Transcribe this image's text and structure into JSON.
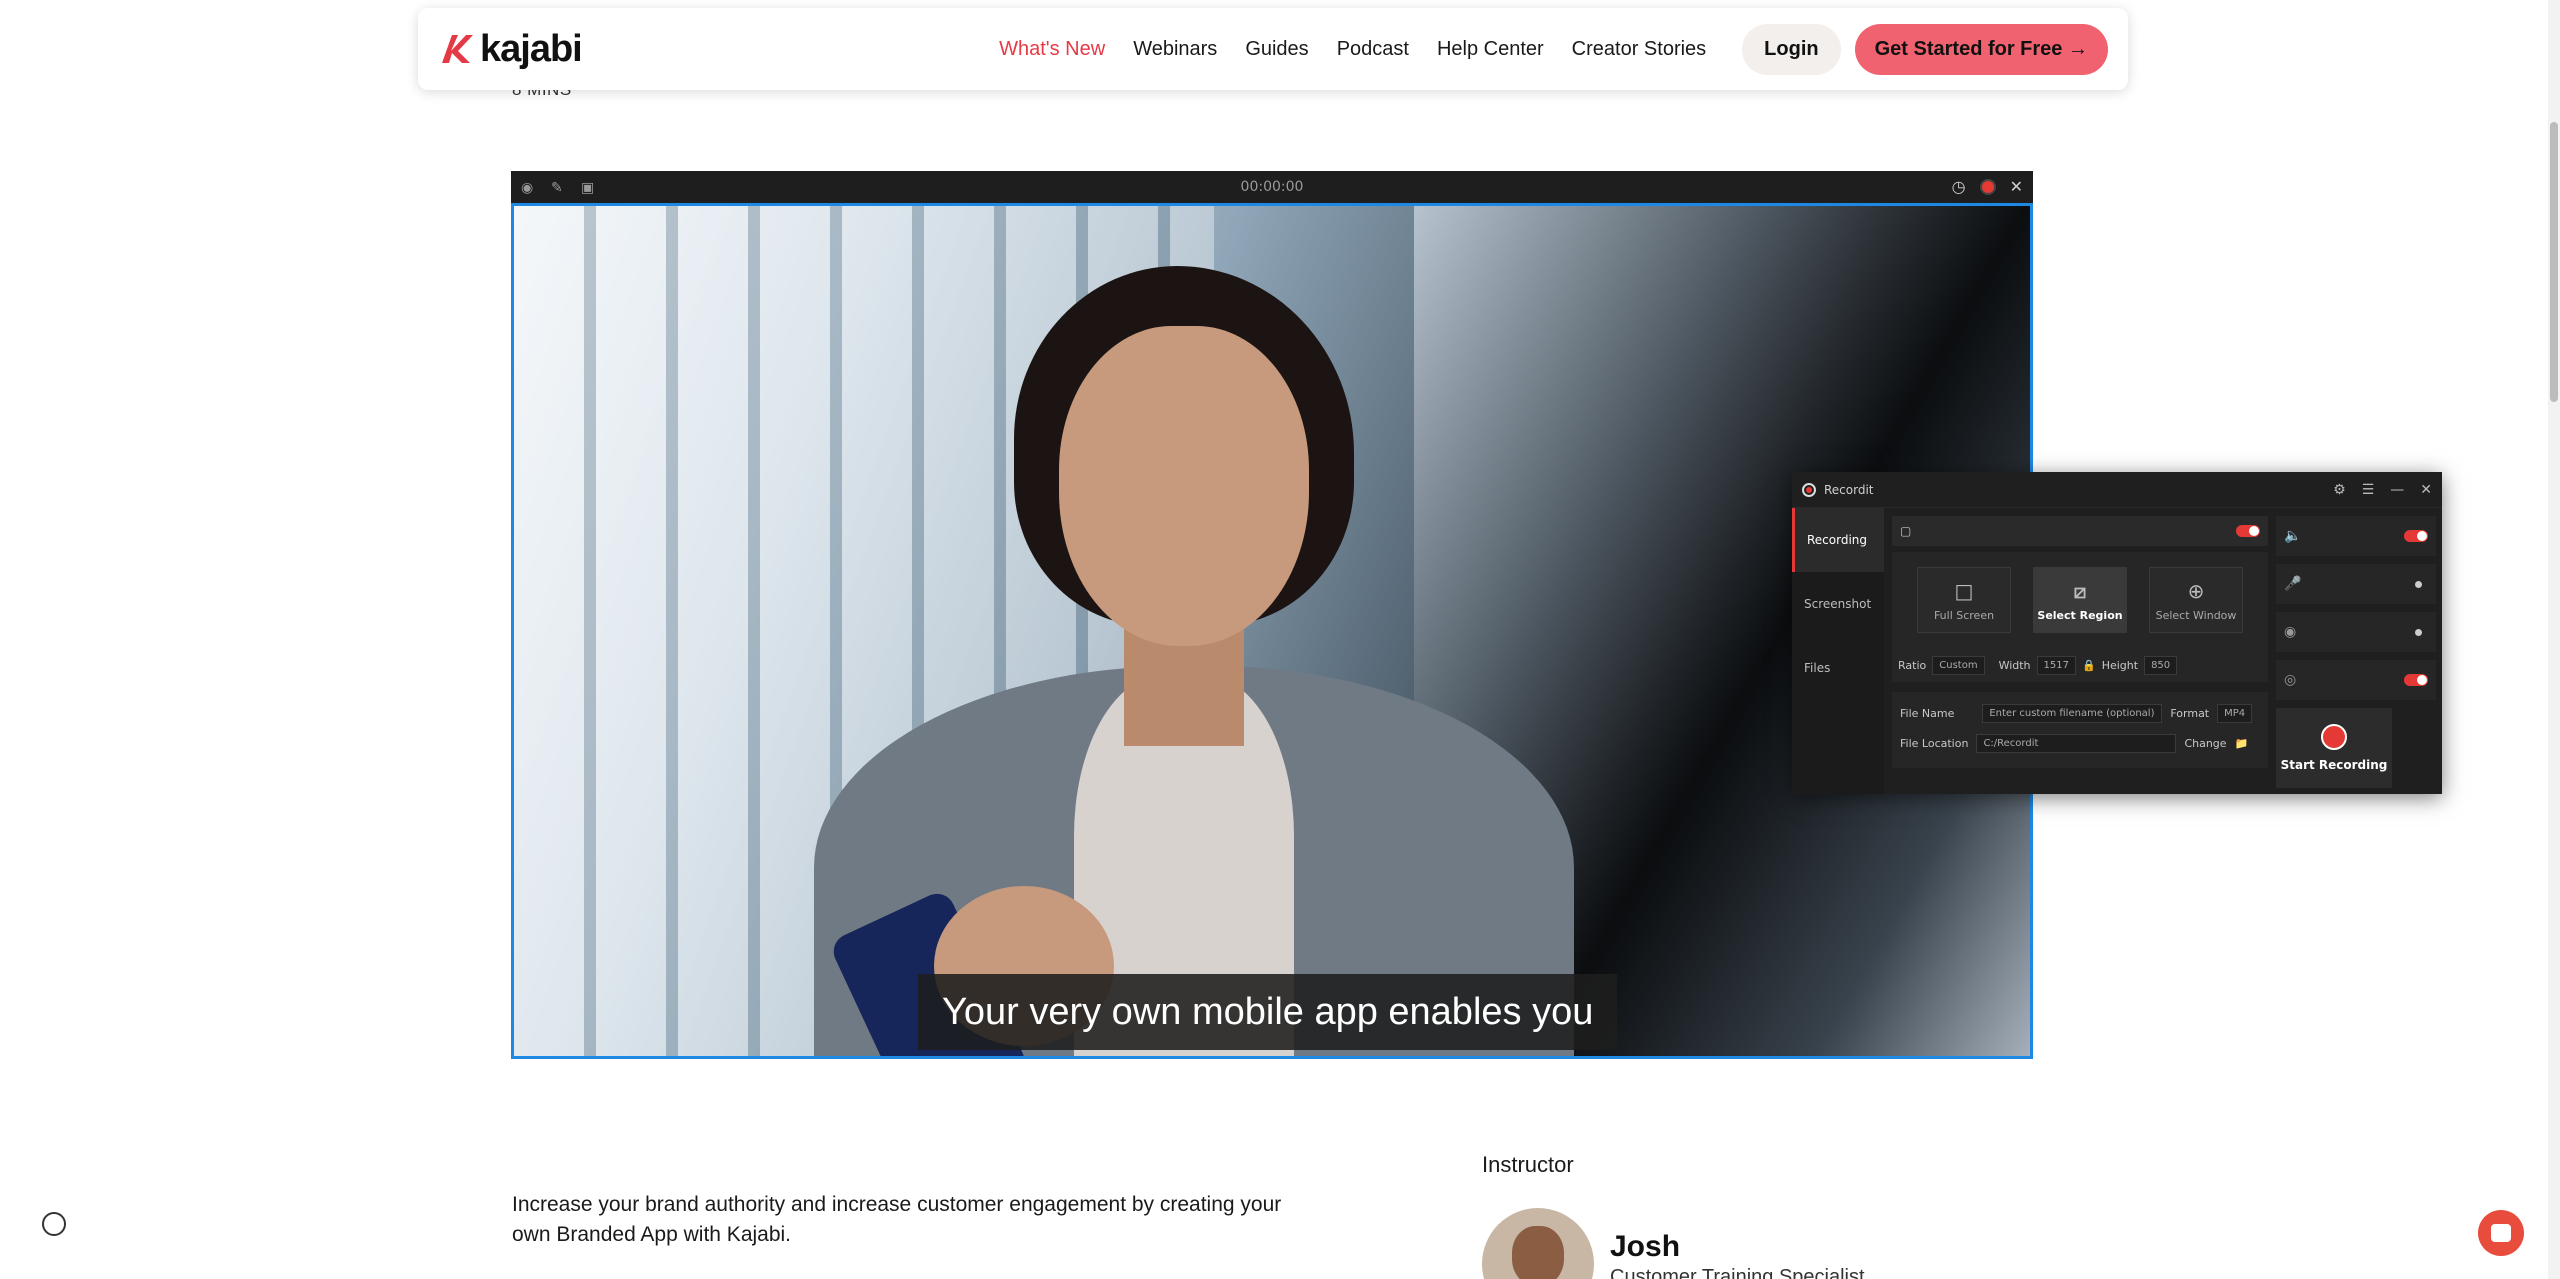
{
  "nav": {
    "logo_text": "kajabi",
    "links": [
      {
        "label": "What's New",
        "active": true
      },
      {
        "label": "Webinars"
      },
      {
        "label": "Guides"
      },
      {
        "label": "Podcast"
      },
      {
        "label": "Help Center"
      },
      {
        "label": "Creator Stories"
      }
    ],
    "login_label": "Login",
    "cta_label": "Get Started for Free →"
  },
  "meta": {
    "read_time": "8 MINS"
  },
  "recorder_bar": {
    "timer": "00:00:00"
  },
  "video": {
    "caption": "Your very own mobile app enables you"
  },
  "recordit": {
    "title": "Recordit",
    "tabs": [
      "Recording",
      "Screenshot",
      "Files"
    ],
    "active_tab": "Recording",
    "modes": [
      "Full Screen",
      "Select Region",
      "Select Window"
    ],
    "selected_mode": "Select Region",
    "ratio_label": "Ratio",
    "ratio_value": "Custom",
    "width_label": "Width",
    "width_value": "1517",
    "height_label": "Height",
    "height_value": "850",
    "file_name_label": "File Name",
    "file_name_placeholder": "Enter custom filename (optional)",
    "format_label": "Format",
    "format_value": "MP4",
    "file_location_label": "File Location",
    "file_location_value": "C:/Recordit",
    "change_label": "Change",
    "start_label": "Start Recording"
  },
  "content": {
    "description": "Increase your brand authority and increase customer engagement by creating your own Branded App with Kajabi.",
    "instructor_heading": "Instructor",
    "instructor_name": "Josh",
    "instructor_role": "Customer Training Specialist"
  },
  "colors": {
    "brand_red": "#e63946",
    "cta": "#f06270",
    "record_red": "#e53935",
    "selection_blue": "#1e88e5"
  }
}
